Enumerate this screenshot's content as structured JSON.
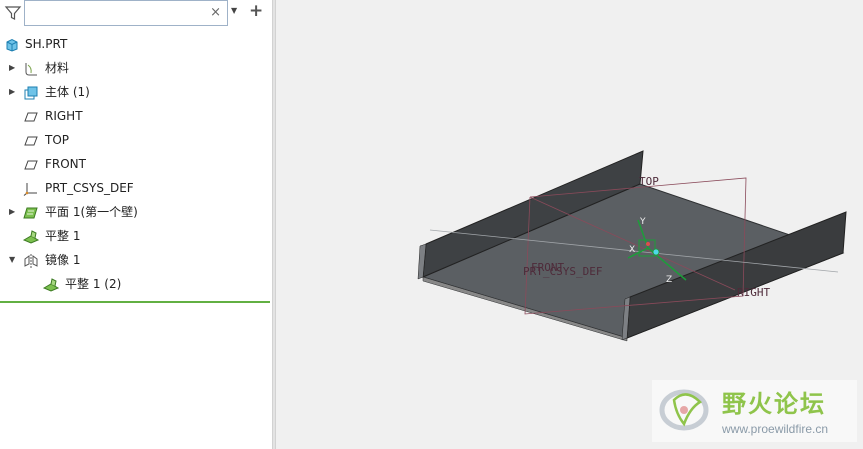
{
  "search": {
    "placeholder": "",
    "clear_glyph": "×",
    "dropdown_glyph": "▼",
    "add_glyph": "+"
  },
  "tree": {
    "items": [
      {
        "label": "SH.PRT",
        "icon": "part-icon"
      },
      {
        "label": "材料",
        "icon": "material-icon"
      },
      {
        "label": "主体 (1)",
        "icon": "body-icon"
      },
      {
        "label": "RIGHT",
        "icon": "datum-plane-icon"
      },
      {
        "label": "TOP",
        "icon": "datum-plane-icon"
      },
      {
        "label": "FRONT",
        "icon": "datum-plane-icon"
      },
      {
        "label": "PRT_CSYS_DEF",
        "icon": "csys-icon"
      },
      {
        "label": "平面 1(第一个壁)",
        "icon": "planar-wall-icon"
      },
      {
        "label": "平整 1",
        "icon": "flat-wall-icon"
      },
      {
        "label": "镜像 1",
        "icon": "mirror-icon"
      },
      {
        "label": "平整 1 (2)",
        "icon": "flat-wall-icon"
      }
    ],
    "expander_glyph": "▶",
    "expanded_glyph": "▼"
  },
  "viewport": {
    "datum_labels": {
      "top": "TOP",
      "front": "FRONT",
      "right": "RIGHT",
      "csys": "PRT_CSYS_DEF"
    },
    "axis_labels": {
      "x": "X",
      "y": "Y",
      "z": "Z"
    }
  },
  "watermark": {
    "title": "野火论坛",
    "url": "www.proewildfire.cn"
  },
  "colors": {
    "accent_green": "#62b043",
    "sheet_gray": "#5b5f63",
    "wall_dark": "#3a3c3e",
    "datum": "#8a4a5a"
  }
}
